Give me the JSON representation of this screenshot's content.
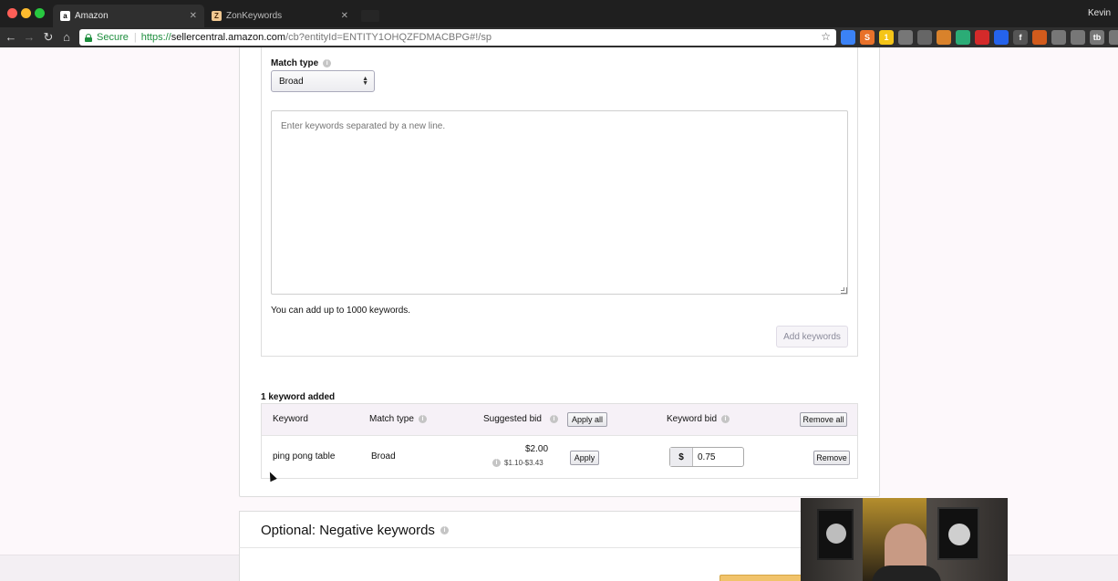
{
  "browser": {
    "tabs": [
      {
        "title": "Amazon",
        "favicon": "amazon-logo-icon"
      },
      {
        "title": "ZonKeywords",
        "favicon": "zonkeywords-logo-icon"
      }
    ],
    "user": "Kevin",
    "address": {
      "secure_label": "Secure",
      "protocol": "https://",
      "host": "sellercentral.amazon.com",
      "path": "/cb?entityId=ENTITY1OHQZFDMACBPG#!/sp"
    },
    "extensions": [
      {
        "icon": "layers-extension-icon",
        "color": "#3b82f6"
      },
      {
        "icon": "s-extension-icon",
        "color": "#e8712a",
        "glyph": "S"
      },
      {
        "icon": "yellow-extension-icon",
        "color": "#f5c518",
        "glyph": "1"
      },
      {
        "icon": "ui-extension-icon",
        "color": "#777777"
      },
      {
        "icon": "screen-extension-icon",
        "color": "#666666"
      },
      {
        "icon": "photo-extension-icon",
        "color": "#d9822b"
      },
      {
        "icon": "slack-extension-icon",
        "color": "#2bac76"
      },
      {
        "icon": "red-circle-extension-icon",
        "color": "#d42a2a"
      },
      {
        "icon": "blue-extension-icon",
        "color": "#2563eb"
      },
      {
        "icon": "facebook-extension-icon",
        "color": "#555555",
        "glyph": "f"
      },
      {
        "icon": "globe-extension-icon",
        "color": "#d25b1c"
      },
      {
        "icon": "speech-extension-icon",
        "color": "#777777"
      },
      {
        "icon": "gear-extension-icon",
        "color": "#777777"
      },
      {
        "icon": "tb-extension-icon",
        "color": "#777777",
        "glyph": "tb"
      },
      {
        "icon": "power-extension-icon",
        "color": "#777777"
      }
    ]
  },
  "form": {
    "match_type_label": "Match type",
    "match_type_value": "Broad",
    "keywords_placeholder": "Enter keywords separated by a new line.",
    "limit_note": "You can add up to 1000 keywords.",
    "add_keywords_label": "Add keywords"
  },
  "added": {
    "count_label": "1 keyword added",
    "headers": {
      "keyword": "Keyword",
      "match_type": "Match type",
      "suggested_bid": "Suggested bid",
      "keyword_bid": "Keyword bid"
    },
    "apply_all_label": "Apply all",
    "remove_all_label": "Remove all",
    "rows": [
      {
        "keyword": "ping pong table",
        "match_type": "Broad",
        "suggested_bid": "$2.00",
        "bid_range": "$1.10-$3.43",
        "apply_label": "Apply",
        "currency": "$",
        "bid_value": "0.75",
        "remove_label": "Remove"
      }
    ]
  },
  "negative": {
    "title": "Optional: Negative keywords"
  },
  "colors": {
    "page_bg": "#fdf8fb",
    "table_header_bg": "#f6f1f7",
    "secure_green": "#1e8e3e",
    "action_orange": "#f1c36b"
  }
}
